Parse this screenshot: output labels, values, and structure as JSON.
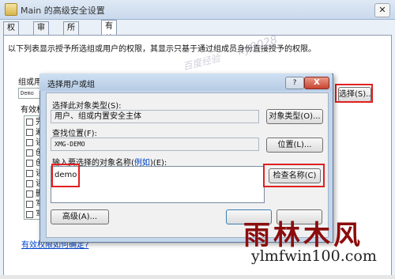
{
  "window": {
    "title": "Main 的高级安全设置",
    "close_label": "✕"
  },
  "tabs": [
    {
      "label": "权限",
      "selected": false
    },
    {
      "label": "审核",
      "selected": false
    },
    {
      "label": "所有者",
      "selected": false
    },
    {
      "label": "有效权限",
      "selected": true
    }
  ],
  "effective": {
    "description": "以下列表显示授予所选组或用户的权限，其显示只基于通过组成员身份直接授予的权限。",
    "group_label": "组或用",
    "group_value": "Demo",
    "select_button": "选择(S)...",
    "perm_label": "有效权",
    "permissions": [
      "完",
      "遍",
      "读",
      "创",
      "创",
      "读",
      "读",
      "删",
      "写",
      "写"
    ],
    "help_link": "有效权限如何确定?"
  },
  "dialog": {
    "title": "选择用户或组",
    "help_label": "?",
    "close_label": "X",
    "type_label": "选择此对象类型(S):",
    "type_value": "用户、组或内置安全主体",
    "type_button": "对象类型(O)...",
    "location_label": "查找位置(F):",
    "location_value": "XMG-DEMO",
    "location_button": "位置(L)...",
    "names_label_prefix": "输入要选择的对象名称(",
    "names_label_link": "例如",
    "names_label_suffix": ")(E):",
    "names_value": "demo",
    "check_button": "检查名称(C)",
    "advanced_button": "高级(A)..."
  },
  "watermark": {
    "line1": "ky9028",
    "line2": "百度经验"
  },
  "logo": {
    "cn": "雨林木风",
    "url": "ylmfwin100.com"
  }
}
